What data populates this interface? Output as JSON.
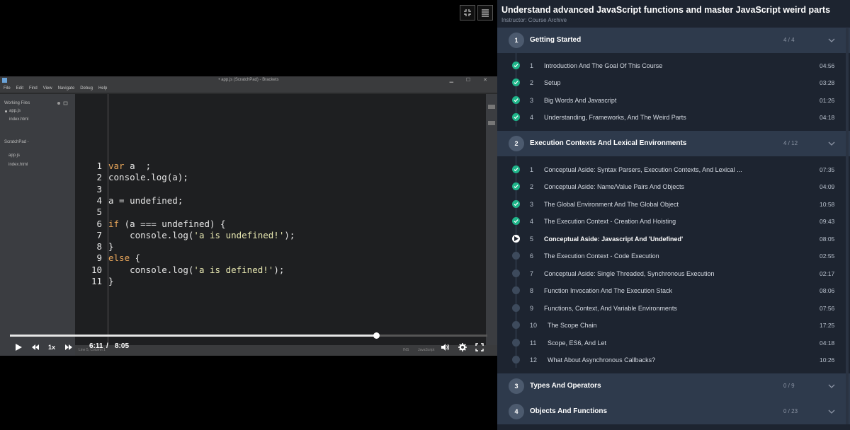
{
  "player": {
    "top_buttons": [
      {
        "name": "exit-fullscreen-button",
        "icon": "compress-icon"
      },
      {
        "name": "toggle-sidebar-button",
        "icon": "list-icon"
      }
    ],
    "editor_window": {
      "title": "• app.js (ScratchPad) - Brackets",
      "menu": [
        "File",
        "Edit",
        "Find",
        "View",
        "Navigate",
        "Debug",
        "Help"
      ],
      "working_files_label": "Working Files",
      "working_files": [
        "app.js",
        "index.html"
      ],
      "project_label": "ScratchPad -",
      "project_files": [
        "app.js",
        "index.html"
      ],
      "code_lines": [
        {
          "n": "1",
          "parts": [
            {
              "t": "var",
              "c": "kw"
            },
            {
              "t": " a  ;",
              "c": ""
            }
          ]
        },
        {
          "n": "2",
          "parts": [
            {
              "t": "console.log(a);",
              "c": ""
            }
          ]
        },
        {
          "n": "3",
          "parts": [
            {
              "t": "",
              "c": ""
            }
          ]
        },
        {
          "n": "4",
          "parts": [
            {
              "t": "a = undefined;",
              "c": ""
            }
          ]
        },
        {
          "n": "5",
          "parts": [
            {
              "t": "",
              "c": ""
            }
          ]
        },
        {
          "n": "6",
          "parts": [
            {
              "t": "if",
              "c": "kw"
            },
            {
              "t": " (a === undefined) {",
              "c": ""
            }
          ]
        },
        {
          "n": "7",
          "parts": [
            {
              "t": "    console.log(",
              "c": ""
            },
            {
              "t": "'a is undefined!'",
              "c": "str"
            },
            {
              "t": ");",
              "c": ""
            }
          ]
        },
        {
          "n": "8",
          "parts": [
            {
              "t": "}",
              "c": ""
            }
          ]
        },
        {
          "n": "9",
          "parts": [
            {
              "t": "else",
              "c": "kw"
            },
            {
              "t": " {",
              "c": ""
            }
          ]
        },
        {
          "n": "10",
          "parts": [
            {
              "t": "    console.log(",
              "c": ""
            },
            {
              "t": "'a is defined!'",
              "c": "str"
            },
            {
              "t": ");",
              "c": ""
            }
          ]
        },
        {
          "n": "11",
          "parts": [
            {
              "t": "}",
              "c": ""
            }
          ]
        }
      ],
      "status_items": [
        "Line 5, Column 1",
        "INS",
        "JavaScript"
      ]
    },
    "progress_fraction": 0.7676,
    "controls": {
      "speed": "1x",
      "current_time": "6:11",
      "separator": "/",
      "duration": "8:05"
    }
  },
  "course": {
    "title": "Understand advanced JavaScript functions and master JavaScript weird parts",
    "instructor": "Instructor: Course Archive",
    "sections": [
      {
        "num": "1",
        "title": "Getting Started",
        "count": "4 / 4",
        "lessons": [
          {
            "num": "1",
            "title": "Introduction And The Goal Of This Course",
            "duration": "04:56",
            "status": "done"
          },
          {
            "num": "2",
            "title": "Setup",
            "duration": "03:28",
            "status": "done"
          },
          {
            "num": "3",
            "title": "Big Words And Javascript",
            "duration": "01:26",
            "status": "done"
          },
          {
            "num": "4",
            "title": "Understanding, Frameworks, And The Weird Parts",
            "duration": "04:18",
            "status": "done"
          }
        ]
      },
      {
        "num": "2",
        "title": "Execution Contexts And Lexical Environments",
        "count": "4 / 12",
        "lessons": [
          {
            "num": "1",
            "title": "Conceptual Aside: Syntax Parsers, Execution Contexts, And Lexical ...",
            "duration": "07:35",
            "status": "done"
          },
          {
            "num": "2",
            "title": "Conceptual Aside: Name/Value Pairs And Objects",
            "duration": "04:09",
            "status": "done"
          },
          {
            "num": "3",
            "title": "The Global Environment And The Global Object",
            "duration": "10:58",
            "status": "done"
          },
          {
            "num": "4",
            "title": "The Execution Context - Creation And Hoisting",
            "duration": "09:43",
            "status": "done"
          },
          {
            "num": "5",
            "title": "Conceptual Aside: Javascript And 'Undefined'",
            "duration": "08:05",
            "status": "current"
          },
          {
            "num": "6",
            "title": "The Execution Context - Code Execution",
            "duration": "02:55",
            "status": "todo"
          },
          {
            "num": "7",
            "title": "Conceptual Aside: Single Threaded, Synchronous Execution",
            "duration": "02:17",
            "status": "todo"
          },
          {
            "num": "8",
            "title": "Function Invocation And The Execution Stack",
            "duration": "08:06",
            "status": "todo"
          },
          {
            "num": "9",
            "title": "Functions, Context, And Variable Environments",
            "duration": "07:56",
            "status": "todo"
          },
          {
            "num": "10",
            "title": "The Scope Chain",
            "duration": "17:25",
            "status": "todo"
          },
          {
            "num": "11",
            "title": "Scope, ES6, And Let",
            "duration": "04:18",
            "status": "todo"
          },
          {
            "num": "12",
            "title": "What About Asynchronous Callbacks?",
            "duration": "10:26",
            "status": "todo"
          }
        ]
      },
      {
        "num": "3",
        "title": "Types And Operators",
        "count": "0 / 9",
        "lessons": []
      },
      {
        "num": "4",
        "title": "Objects And Functions",
        "count": "0 / 23",
        "lessons": []
      }
    ]
  },
  "colors": {
    "done": "#1fb58a",
    "panel_bg": "#1d2430",
    "section_bg": "#2e3a4c"
  }
}
